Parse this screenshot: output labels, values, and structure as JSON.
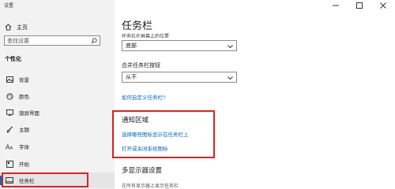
{
  "window": {
    "title": "设置"
  },
  "sidebar": {
    "home_label": "主页",
    "search_placeholder": "查找设置",
    "section_title": "个性化",
    "items": [
      {
        "label": "背景",
        "icon": "image-icon"
      },
      {
        "label": "颜色",
        "icon": "palette-icon"
      },
      {
        "label": "锁屏界面",
        "icon": "lock-screen-icon"
      },
      {
        "label": "主题",
        "icon": "brush-icon"
      },
      {
        "label": "字体",
        "icon": "font-icon"
      },
      {
        "label": "开始",
        "icon": "start-icon"
      },
      {
        "label": "任务栏",
        "icon": "taskbar-icon",
        "active": true
      }
    ]
  },
  "main": {
    "title": "任务栏",
    "cut_label": "任务栏在屏幕上的位置",
    "position_select": {
      "value": "底部"
    },
    "combine_label": "合并任务栏按钮",
    "combine_select": {
      "value": "从不"
    },
    "customize_link": "如何自定义任务栏?",
    "notification": {
      "title": "通知区域",
      "link1": "选择哪些图标显示在任务栏上",
      "link2": "打开或关闭系统图标"
    },
    "multi_display_title": "多显示器设置",
    "multi_display_sub": "在所有显示器上显示任务栏"
  },
  "colors": {
    "accent": "#0067c0",
    "highlight": "#e02020"
  }
}
